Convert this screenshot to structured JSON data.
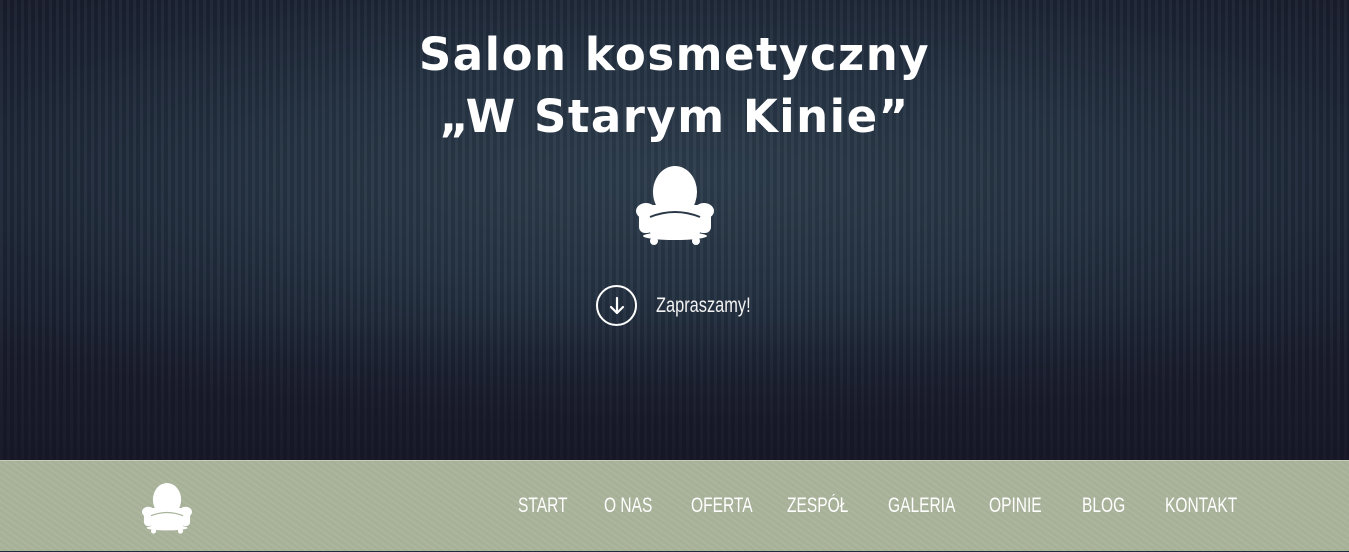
{
  "hero": {
    "title_line1": "Salon kosmetyczny",
    "title_line2": "„W Starym Kinie”",
    "emblem_icon": "armchair-icon",
    "cta_icon": "arrow-down-circle-icon",
    "cta_label": "Zapraszamy!"
  },
  "nav": {
    "logo_icon": "armchair-icon",
    "items": [
      {
        "label": "START"
      },
      {
        "label": "O NAS"
      },
      {
        "label": "OFERTA"
      },
      {
        "label": "ZESPÓŁ"
      },
      {
        "label": "GALERIA"
      },
      {
        "label": "OPINIE"
      },
      {
        "label": "BLOG"
      },
      {
        "label": "KONTAKT"
      }
    ]
  },
  "colors": {
    "hero_background": "#243242",
    "nav_background": "#aab49b",
    "text": "#ffffff"
  }
}
